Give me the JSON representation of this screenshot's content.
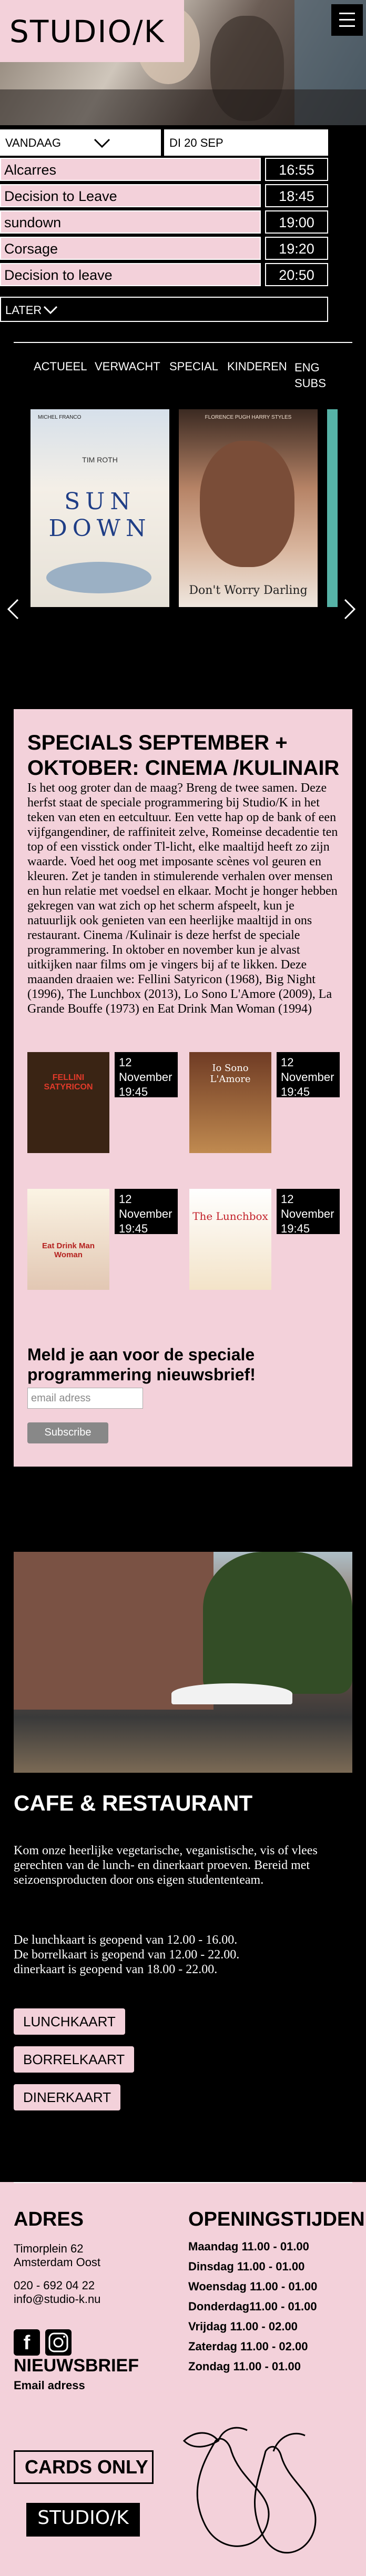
{
  "header": {
    "logo": "STUDIO/K"
  },
  "schedule": {
    "day_select": "VANDAAG",
    "date_select": "DI 20 SEP",
    "screenings": [
      {
        "title": "Alcarres",
        "time": "16:55"
      },
      {
        "title": "Decision to Leave",
        "time": "18:45"
      },
      {
        "title": "sundown",
        "time": "19:00"
      },
      {
        "title": "Corsage",
        "time": "19:20"
      },
      {
        "title": "Decision to leave",
        "time": "20:50"
      }
    ],
    "later": "LATER"
  },
  "tabs": [
    "ACTUEEL",
    "VERWACHT",
    "SPECIAL",
    "KINDEREN",
    "ENG SUBS"
  ],
  "posters": [
    {
      "title_top": "MICHEL FRANCO",
      "title": "SUN DOWN",
      "credits": "TIM ROTH"
    },
    {
      "names": "FLORENCE PUGH  HARRY STYLES",
      "title": "Don't Worry Darling"
    }
  ],
  "specials": {
    "title": "SPECIALS SEPTEMBER + OKTOBER: CINEMA /KULINAIR",
    "text": "Is het oog groter dan de maag? Breng de twee samen. Deze herfst staat de speciale programmering bij Studio/K in het teken van eten en eetcultuur. Een vette hap op de bank of een vijfgangendiner, de raffiniteit zelve, Romeinse decadentie ten top of een visstick onder Tl-licht, elke maaltijd heeft zo zijn waarde. Voed het oog met imposante scènes vol geuren en kleuren. Zet je tanden in stimulerende verhalen over mensen en hun relatie met voedsel en elkaar. Mocht je honger hebben gekregen van wat zich op het scherm afspeelt, kun je natuurlijk ook genieten van een heerlijke maaltijd in ons restaurant. Cinema /Kulinair is deze herfst de speciale programmering. In oktober en november kun je alvast uitkijken naar films om je vingers bij af te likken. Deze maanden draaien we: Fellini Satyricon (1968), Big Night (1996), The Lunchbox (2013), Lo Sono L'Amore (2009), La Grande Bouffe (1973) en Eat Drink Man Woman (1994)",
    "films": [
      {
        "poster": "FELLINI SATYRICON",
        "date": "12 November",
        "time": "19:45"
      },
      {
        "poster": "Io Sono L'Amore",
        "date": "12 November",
        "time": "19:45"
      },
      {
        "poster": "Eat Drink Man Woman",
        "date": "12 November",
        "time": "19:45"
      },
      {
        "poster": "The Lunchbox",
        "date": "12 November",
        "time": "19:45"
      }
    ],
    "newsletter_title": "Meld je aan voor de speciale programmering nieuwsbrief!",
    "email_placeholder": "email adress",
    "subscribe": "Subscribe"
  },
  "cafe": {
    "title": "CAFE & RESTAURANT",
    "text": "Kom onze heerlijke vegetarische, veganistische, vis of vlees gerechten van de lunch- en dinerkaart proeven. Bereid met seizoensproducten door ons eigen studententeam.",
    "hours": [
      "De lunchkaart is geopend van 12.00 - 16.00.",
      "De borrelkaart is geopend van 12.00 - 22.00.",
      "dinerkaart is geopend van 18.00 - 22.00."
    ],
    "buttons": [
      "LUNCHKAART",
      "BORRELKAART",
      "DINERKAART"
    ]
  },
  "footer": {
    "address_title": "ADRES",
    "address": [
      "Timorplein 62",
      "Amsterdam Oost"
    ],
    "phone": "020 - 692 04 22",
    "email": "info@studio-k.nu",
    "newsletter_title": "NIEUWSBRIEF",
    "newsletter_sub": "Email adress",
    "hours_title": "OPENINGSTIJDEN",
    "hours": [
      "Maandag 11.00 - 01.00",
      "Dinsdag 11.00 - 01.00",
      "Woensdag 11.00 - 01.00",
      "Donderdag11.00 - 01.00",
      "Vrijdag 11.00 - 02.00",
      "Zaterdag 11.00 - 02.00",
      "Zondag 11.00 - 01.00"
    ],
    "cards_only": "CARDS ONLY",
    "logo": "STUDIO/K"
  },
  "colors": {
    "pink": "#f3d1da",
    "black": "#000000",
    "white": "#ffffff",
    "grey": "#888888"
  }
}
